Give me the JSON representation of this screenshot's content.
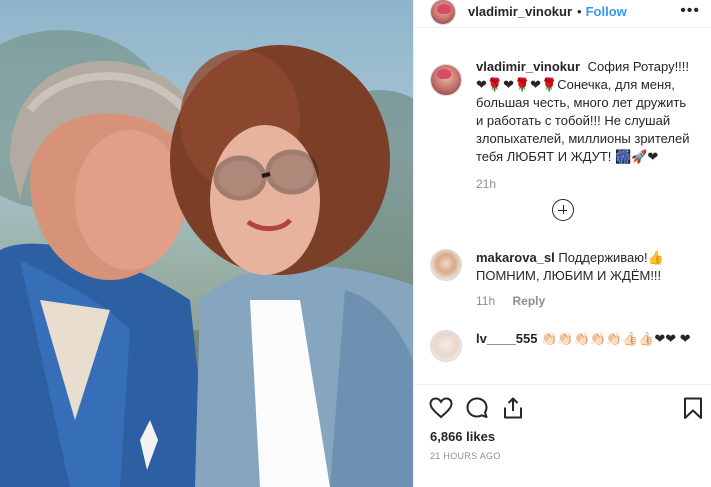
{
  "post": {
    "author": "vladimir_vinokur",
    "follow_label": "Follow",
    "separator": "•",
    "more_glyph": "•••"
  },
  "caption": {
    "username": "vladimir_vinokur",
    "text": "София Ротару!!!! ❤🌹❤🌹❤🌹Сонечка, для меня, большая честь, много лет дружить и работать с тобой!!! Не слушай злопыхателей, миллионы зрителей тебя ЛЮБЯТ И ЖДУТ! 🎆🚀❤",
    "time": "21h"
  },
  "comments": [
    {
      "username": "makarova_sl",
      "text": "Поддерживаю!👍 ПОМНИМ, ЛЮБИМ И ЖДЁМ!!!",
      "time": "11h",
      "reply_label": "Reply"
    },
    {
      "username": "lv____555",
      "text": "👏🏻👏🏻👏🏻👏🏻👏🏻👍🏻👍🏻❤❤ ❤",
      "time": "",
      "reply_label": ""
    }
  ],
  "footer": {
    "likes": "6,866 likes",
    "posted": "21 HOURS AGO"
  },
  "icons": {
    "like": "heart-icon",
    "comment": "comment-icon",
    "share": "share-icon",
    "save": "bookmark-icon",
    "add": "plus-circle-icon"
  },
  "colors": {
    "link": "#3897f0",
    "muted": "#8e8e8e",
    "text": "#262626"
  }
}
